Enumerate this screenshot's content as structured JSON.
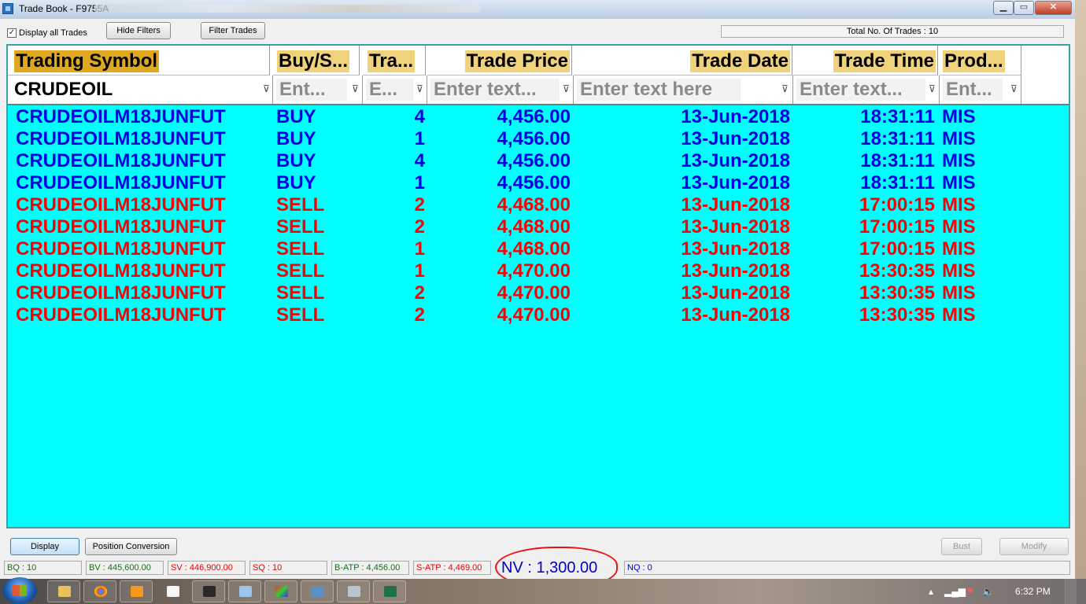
{
  "window": {
    "title": "Trade Book - F9755A"
  },
  "toolbar": {
    "display_all_label": "Display all Trades",
    "display_all_checked": "✓",
    "hide_filters": "Hide Filters",
    "filter_trades": "Filter Trades",
    "total_trades": "Total No. Of Trades : 10"
  },
  "columns": {
    "symbol": "Trading Symbol",
    "side": "Buy/S...",
    "qty": "Tra...",
    "price": "Trade Price",
    "date": "Trade Date",
    "time": "Trade Time",
    "product": "Prod..."
  },
  "filters": {
    "symbol": "CRUDEOIL",
    "side": "Ent...",
    "qty": "E...",
    "price": "Enter text...",
    "date": "Enter text here",
    "time": "Enter text...",
    "product": "Ent..."
  },
  "colors": {
    "buy": "#0000e6",
    "sell": "#ff0000",
    "grid_bg": "#00ffff",
    "header_highlight": "#f0d27a"
  },
  "trades": [
    {
      "symbol": "CRUDEOILM18JUNFUT",
      "side": "BUY",
      "qty": "4",
      "price": "4,456.00",
      "date": "13-Jun-2018",
      "time": "18:31:11",
      "product": "MIS"
    },
    {
      "symbol": "CRUDEOILM18JUNFUT",
      "side": "BUY",
      "qty": "1",
      "price": "4,456.00",
      "date": "13-Jun-2018",
      "time": "18:31:11",
      "product": "MIS"
    },
    {
      "symbol": "CRUDEOILM18JUNFUT",
      "side": "BUY",
      "qty": "4",
      "price": "4,456.00",
      "date": "13-Jun-2018",
      "time": "18:31:11",
      "product": "MIS"
    },
    {
      "symbol": "CRUDEOILM18JUNFUT",
      "side": "BUY",
      "qty": "1",
      "price": "4,456.00",
      "date": "13-Jun-2018",
      "time": "18:31:11",
      "product": "MIS"
    },
    {
      "symbol": "CRUDEOILM18JUNFUT",
      "side": "SELL",
      "qty": "2",
      "price": "4,468.00",
      "date": "13-Jun-2018",
      "time": "17:00:15",
      "product": "MIS"
    },
    {
      "symbol": "CRUDEOILM18JUNFUT",
      "side": "SELL",
      "qty": "2",
      "price": "4,468.00",
      "date": "13-Jun-2018",
      "time": "17:00:15",
      "product": "MIS"
    },
    {
      "symbol": "CRUDEOILM18JUNFUT",
      "side": "SELL",
      "qty": "1",
      "price": "4,468.00",
      "date": "13-Jun-2018",
      "time": "17:00:15",
      "product": "MIS"
    },
    {
      "symbol": "CRUDEOILM18JUNFUT",
      "side": "SELL",
      "qty": "1",
      "price": "4,470.00",
      "date": "13-Jun-2018",
      "time": "13:30:35",
      "product": "MIS"
    },
    {
      "symbol": "CRUDEOILM18JUNFUT",
      "side": "SELL",
      "qty": "2",
      "price": "4,470.00",
      "date": "13-Jun-2018",
      "time": "13:30:35",
      "product": "MIS"
    },
    {
      "symbol": "CRUDEOILM18JUNFUT",
      "side": "SELL",
      "qty": "2",
      "price": "4,470.00",
      "date": "13-Jun-2018",
      "time": "13:30:35",
      "product": "MIS"
    }
  ],
  "bottom": {
    "display": "Display",
    "position_conversion": "Position Conversion",
    "bust": "Bust",
    "modify": "Modify"
  },
  "status": {
    "bq": "BQ : 10",
    "bv": "BV : 445,600.00",
    "sv": "SV : 446,900.00",
    "sq": "SQ : 10",
    "batp": "B-ATP : 4,456.00",
    "satp": "S-ATP : 4,469.00",
    "nv": "NV : 1,300.00",
    "nq": "NQ : 0"
  },
  "taskbar": {
    "clock": "6:32 PM"
  }
}
